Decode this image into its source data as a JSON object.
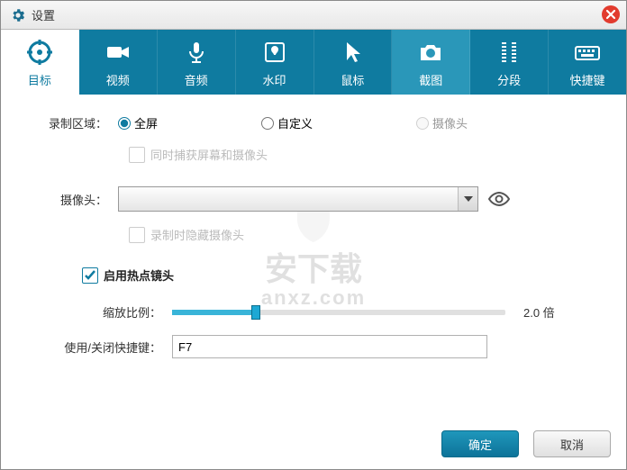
{
  "window": {
    "title": "设置"
  },
  "tabs": [
    {
      "label": "目标"
    },
    {
      "label": "视频"
    },
    {
      "label": "音频"
    },
    {
      "label": "水印"
    },
    {
      "label": "鼠标"
    },
    {
      "label": "截图"
    },
    {
      "label": "分段"
    },
    {
      "label": "快捷键"
    }
  ],
  "form": {
    "record_area_label": "录制区域：",
    "radio_fullscreen": "全屏",
    "radio_custom": "自定义",
    "radio_camera": "摄像头",
    "capture_both": "同时捕获屏幕和摄像头",
    "camera_label": "摄像头：",
    "hide_camera_on_record": "录制时隐藏摄像头",
    "enable_hotspot": "启用热点镜头",
    "zoom_label": "缩放比例：",
    "zoom_value": "2.0 倍",
    "hotkey_label": "使用/关闭快捷键：",
    "hotkey_value": "F7"
  },
  "buttons": {
    "ok": "确定",
    "cancel": "取消"
  },
  "watermark": {
    "line1": "安下载",
    "line2": "anxz.com"
  }
}
